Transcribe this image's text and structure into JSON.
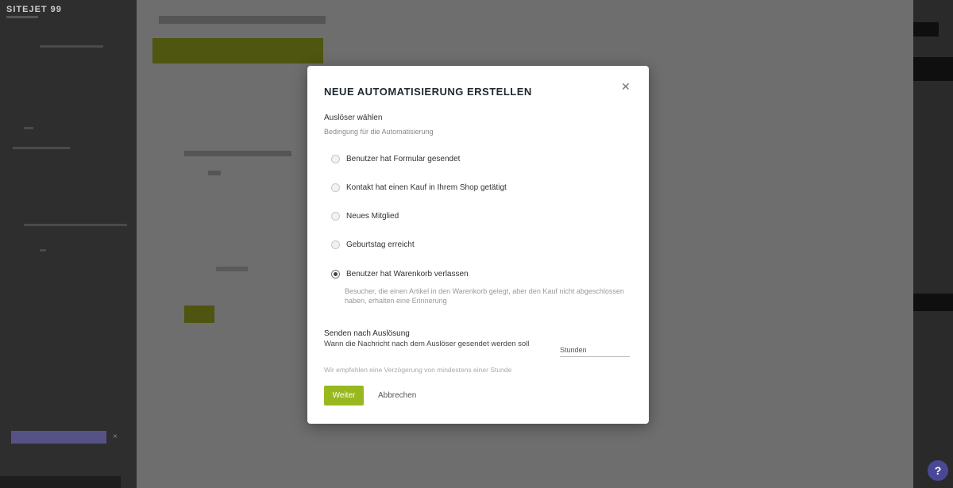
{
  "sidebar": {
    "brand": "SITEJET 99"
  },
  "modal": {
    "title": "NEUE AUTOMATISIERUNG ERSTELLEN",
    "close_icon": "close-icon",
    "trigger_label": "Auslöser wählen",
    "trigger_hint": "Bedingung für die Automatisierung",
    "options": [
      {
        "label": "Benutzer hat Formular gesendet",
        "checked": false
      },
      {
        "label": "Kontakt hat einen Kauf in Ihrem Shop getätigt",
        "checked": false
      },
      {
        "label": "Neues Mitglied",
        "checked": false
      },
      {
        "label": "Geburtstag erreicht",
        "checked": false
      },
      {
        "label": "Benutzer hat Warenkorb verlassen",
        "checked": true
      }
    ],
    "checked_desc": "Besucher, die einen Artikel in den Warenkorb gelegt, aber den Kauf nicht abgeschlossen haben, erhalten eine Erinnerung",
    "section_title": "Senden nach Auslösung",
    "section_desc": "Wann die Nachricht nach dem Auslöser gesendet werden soll",
    "section_input": "Stunden",
    "section_note": "Wir empfehlen eine Verzögerung von mindestens einer Stunde",
    "next_label": "Weiter",
    "cancel_label": "Abbrechen"
  },
  "colors": {
    "accent": "#98b81f",
    "promo": "#565286",
    "help": "#4a4896"
  }
}
